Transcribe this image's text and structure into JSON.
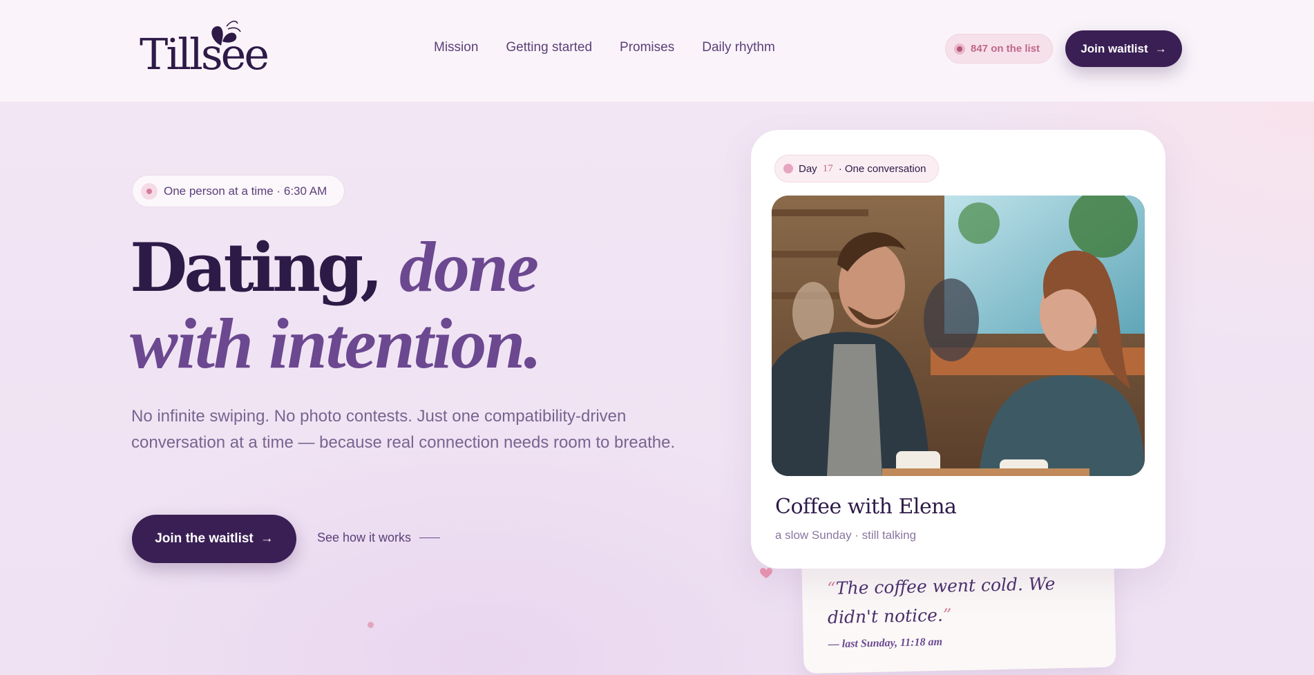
{
  "brand": {
    "name": "Tillsee"
  },
  "nav": {
    "items": [
      "Mission",
      "Getting started",
      "Promises",
      "Daily rhythm"
    ]
  },
  "header": {
    "counter": "847 on the list",
    "join_label": "Join waitlist",
    "join_arrow": "→"
  },
  "hero": {
    "tag": "One person at a time · 6:30 AM",
    "headline_a": "Dating,",
    "headline_b": "done",
    "headline_c": "with intention.",
    "subcopy": "No infinite swiping. No photo contests. Just one compatibility-driven conversation at a time — because real connection needs room to breathe.",
    "cta_primary": "Join the waitlist",
    "cta_arrow": "→",
    "cta_secondary": "See how it works"
  },
  "card": {
    "pill_prefix": "Day",
    "pill_day": "17",
    "pill_suffix": "· One conversation",
    "title": "Coffee with Elena",
    "subtitle": "a slow Sunday · still talking"
  },
  "note": {
    "quote": "The coffee went cold. We didn't notice.",
    "open_quote": "“",
    "close_quote": "”",
    "signature": "— last Sunday, 11:18 am"
  },
  "colors": {
    "brand_dark": "#3a1f55",
    "accent_purple": "#6b4890",
    "accent_pink": "#d77b9c"
  },
  "icons": {
    "logo_mark": "butterfly-icon",
    "heart": "heart-icon",
    "live_dot": "dot-icon"
  }
}
